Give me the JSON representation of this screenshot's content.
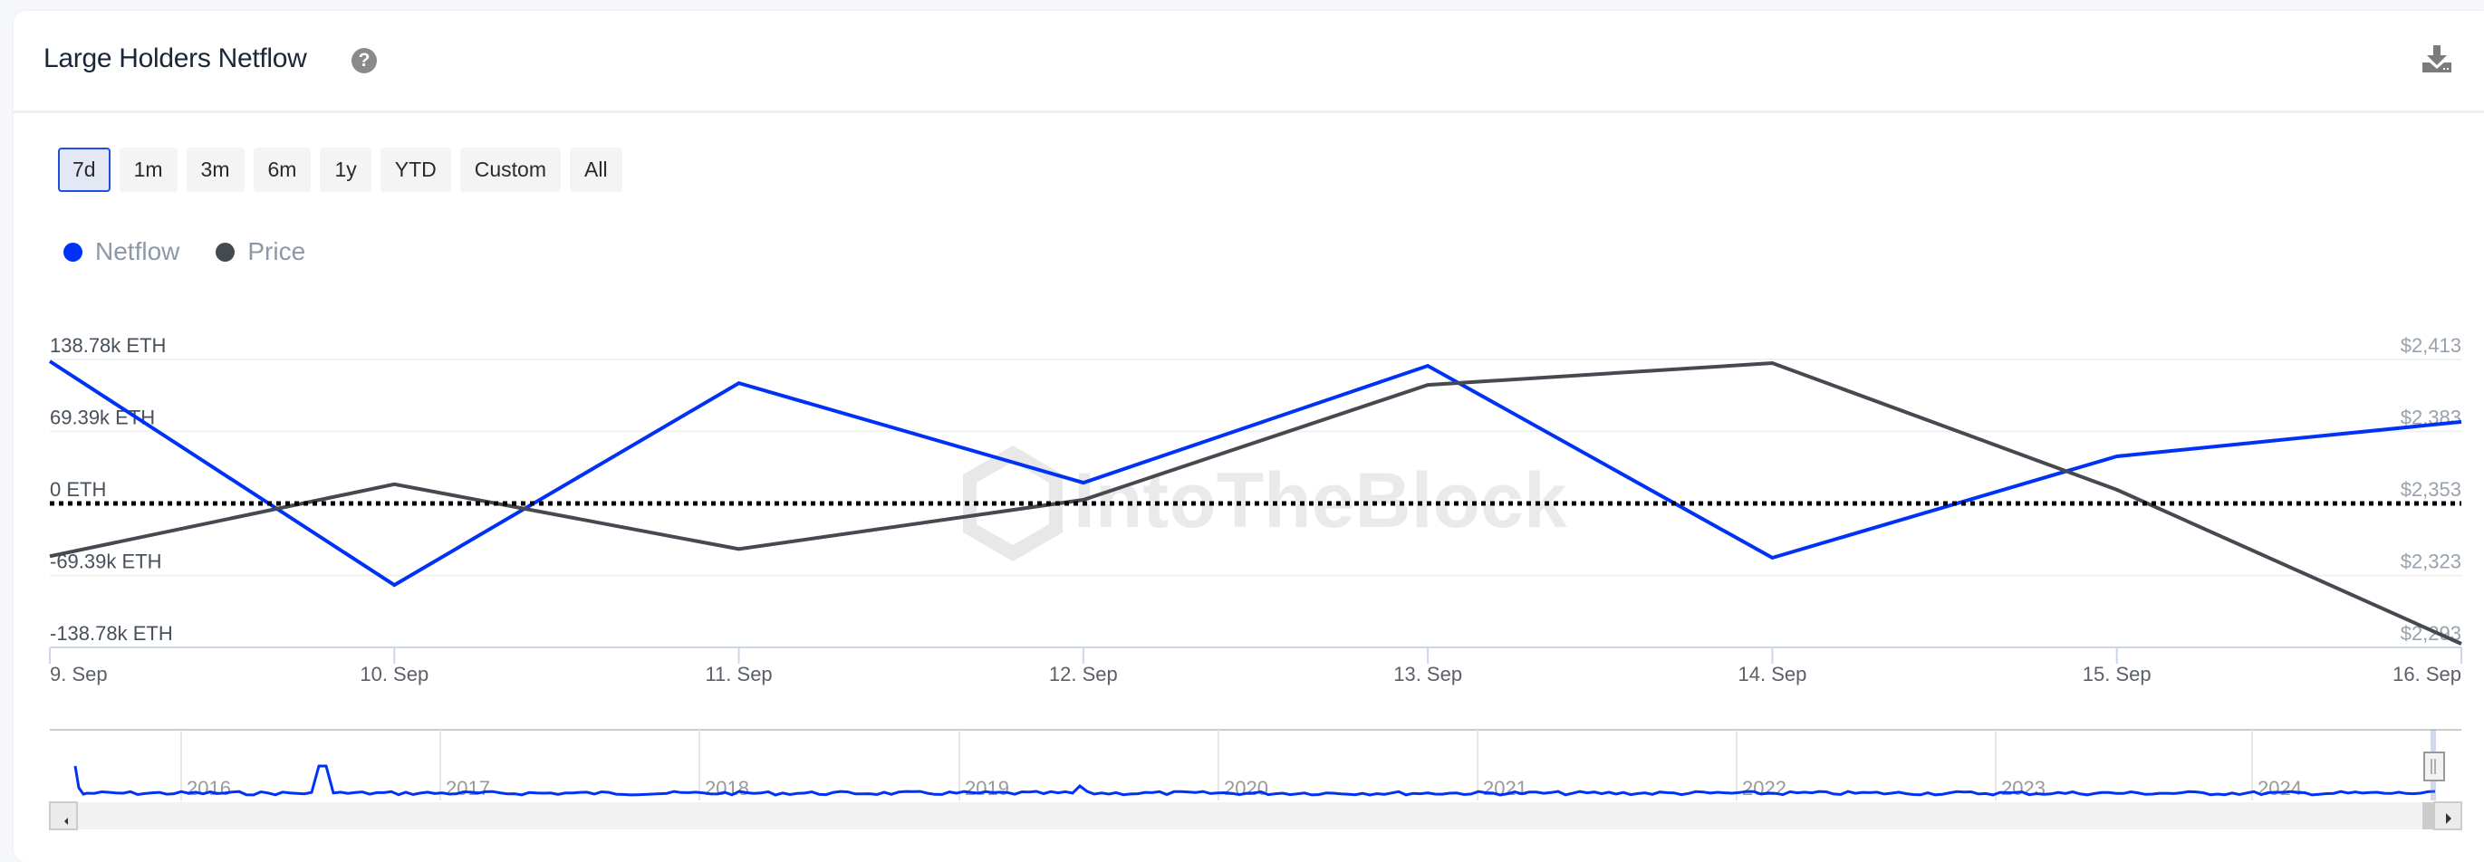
{
  "card": {
    "title": "Large Holders Netflow",
    "help_icon": "question-circle-icon",
    "download_icon": "download-icon"
  },
  "ranges": [
    {
      "label": "7d",
      "active": true
    },
    {
      "label": "1m",
      "active": false
    },
    {
      "label": "3m",
      "active": false
    },
    {
      "label": "6m",
      "active": false
    },
    {
      "label": "1y",
      "active": false
    },
    {
      "label": "YTD",
      "active": false
    },
    {
      "label": "Custom",
      "active": false
    },
    {
      "label": "All",
      "active": false
    }
  ],
  "legend": [
    {
      "label": "Netflow",
      "color": "#0032f5"
    },
    {
      "label": "Price",
      "color": "#454a50"
    }
  ],
  "watermark": "IntoTheBlock",
  "chart_data": {
    "type": "line",
    "title": "Large Holders Netflow",
    "x": [
      "9. Sep",
      "10. Sep",
      "11. Sep",
      "12. Sep",
      "13. Sep",
      "14. Sep",
      "15. Sep",
      "16. Sep"
    ],
    "series": [
      {
        "name": "Netflow",
        "axis": "left",
        "unit": "ETH",
        "color": "#0032f5",
        "values": [
          137000,
          -78600,
          116000,
          20000,
          132700,
          -52400,
          45400,
          78600
        ]
      },
      {
        "name": "Price",
        "axis": "right",
        "unit": "USD",
        "color": "#454a50",
        "values": [
          2331,
          2361,
          2334,
          2354.5,
          2402.4,
          2411.5,
          2358.7,
          2294.5
        ]
      }
    ],
    "y_left": {
      "range": [
        -138780,
        138780
      ],
      "ticks": [
        138780,
        69390,
        0,
        -69390,
        -138780
      ],
      "tick_labels": [
        "138.78k ETH",
        "69.39k ETH",
        "0 ETH",
        "-69.39k ETH",
        "-138.78k ETH"
      ]
    },
    "y_right": {
      "range": [
        2293,
        2413
      ],
      "ticks": [
        2413,
        2383,
        2353,
        2323,
        2293
      ],
      "tick_labels": [
        "$2,413",
        "$2,383",
        "$2,353",
        "$2,323",
        "$2,293"
      ]
    },
    "zero_line": "dotted",
    "grid": true,
    "legend_position": "top-left",
    "navigator": {
      "years": [
        "2016",
        "2017",
        "2018",
        "2019",
        "2020",
        "2021",
        "2022",
        "2023",
        "2024"
      ],
      "series_name": "Netflow"
    }
  }
}
